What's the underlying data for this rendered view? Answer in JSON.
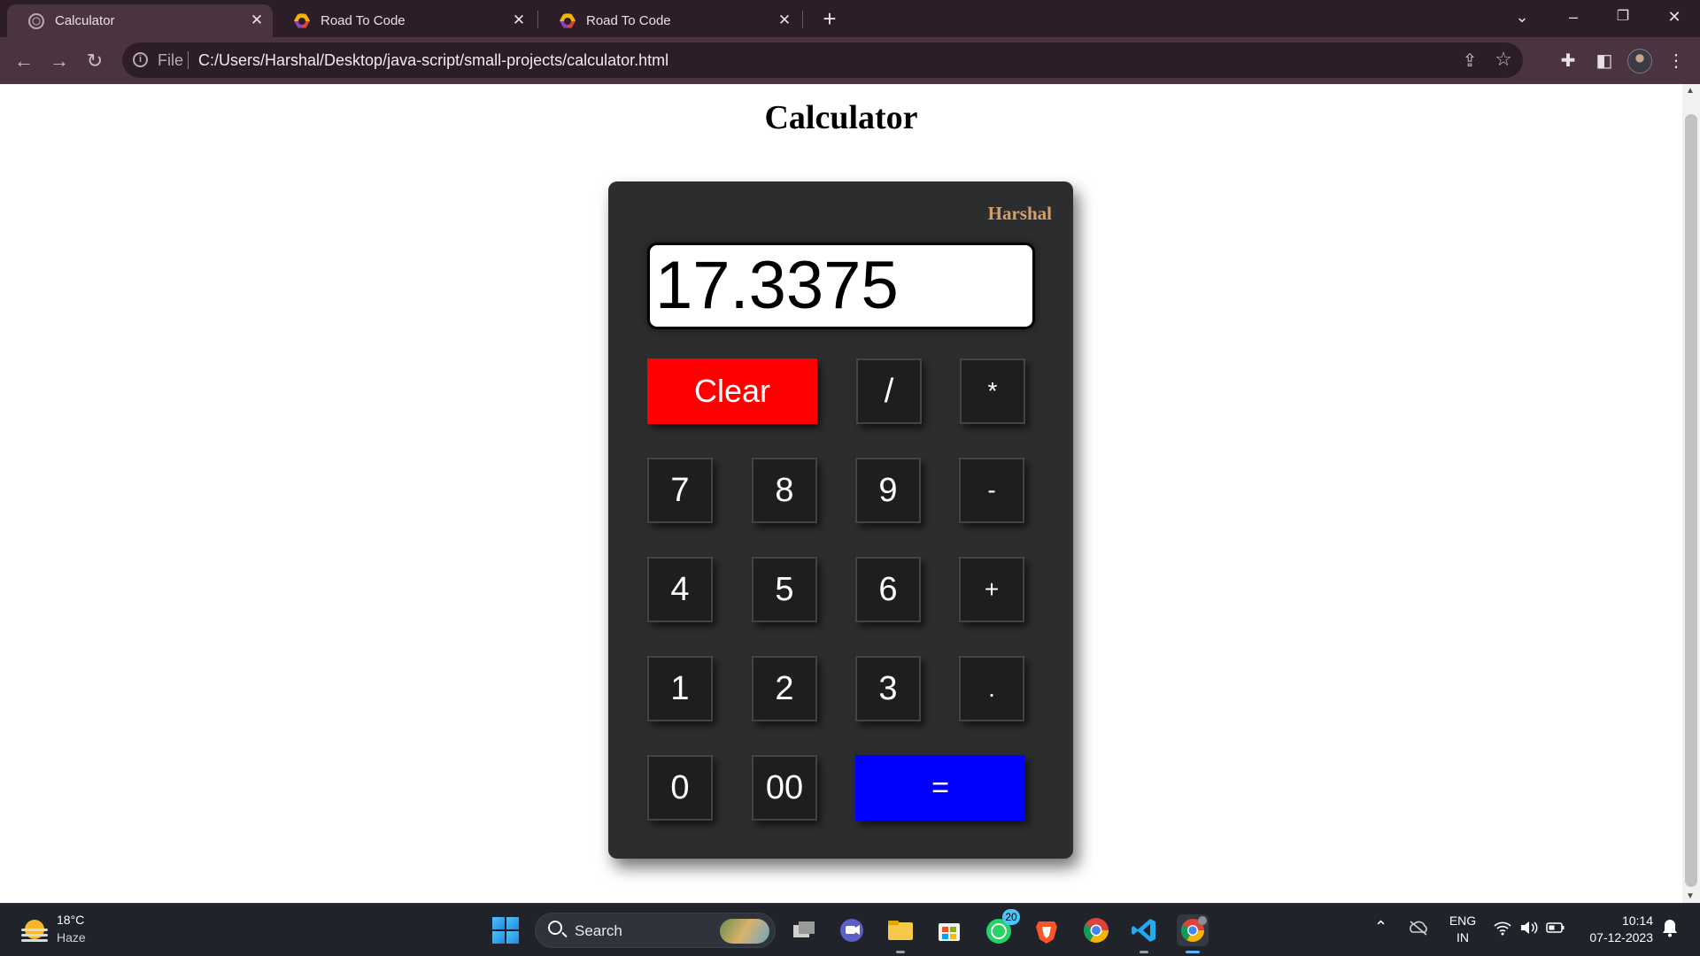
{
  "browser": {
    "tabs": [
      {
        "title": "Calculator",
        "active": true
      },
      {
        "title": "Road To Code",
        "active": false
      },
      {
        "title": "Road To Code",
        "active": false
      }
    ],
    "address": {
      "scheme_label": "File",
      "url": "C:/Users/Harshal/Desktop/java-script/small-projects/calculator.html"
    }
  },
  "page": {
    "heading": "Calculator",
    "calculator": {
      "author": "Harshal",
      "display_value": "17.3375",
      "keys": {
        "clear": "Clear",
        "divide": "/",
        "multiply": "*",
        "seven": "7",
        "eight": "8",
        "nine": "9",
        "minus": "-",
        "four": "4",
        "five": "5",
        "six": "6",
        "plus": "+",
        "one": "1",
        "two": "2",
        "three": "3",
        "dot": ".",
        "zero": "0",
        "double_zero": "00",
        "equals": "="
      },
      "colors": {
        "body": "#2b2d2f",
        "key": "#1e1e1e",
        "clear": "#ff0000",
        "equals": "#0000ff",
        "author": "#d2a06b"
      }
    }
  },
  "taskbar": {
    "weather": {
      "temp": "18°C",
      "desc": "Haze"
    },
    "search_label": "Search",
    "whatsapp_badge": "20",
    "language": {
      "line1": "ENG",
      "line2": "IN"
    },
    "clock": {
      "time": "10:14",
      "date": "07-12-2023"
    }
  }
}
